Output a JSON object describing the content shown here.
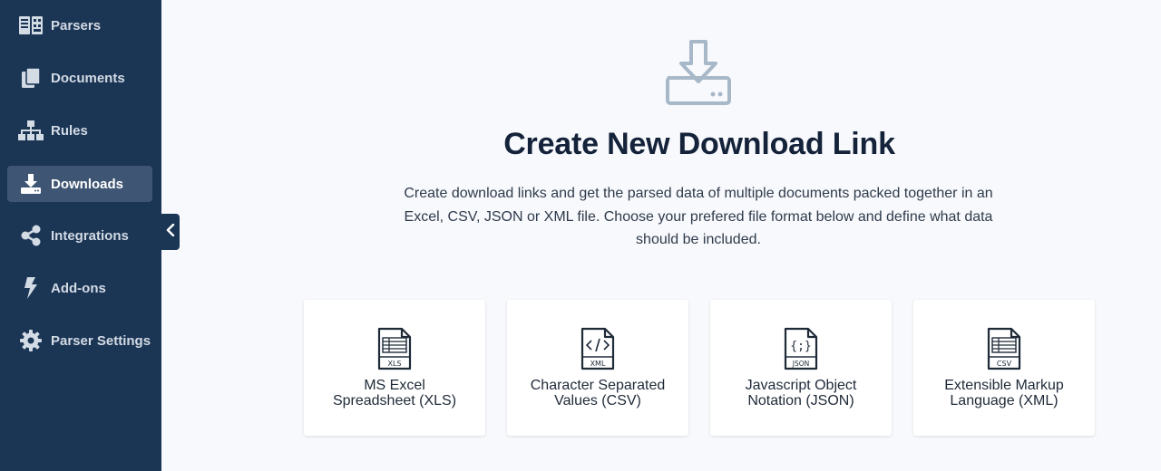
{
  "sidebar": {
    "items": [
      {
        "label": "Parsers",
        "icon": "parsers-icon"
      },
      {
        "label": "Documents",
        "icon": "documents-icon"
      },
      {
        "label": "Rules",
        "icon": "rules-icon"
      },
      {
        "label": "Downloads",
        "icon": "downloads-icon",
        "active": true
      },
      {
        "label": "Integrations",
        "icon": "share-icon"
      },
      {
        "label": "Add-ons",
        "icon": "lightning-icon"
      },
      {
        "label": "Parser Settings",
        "icon": "gear-icon"
      }
    ]
  },
  "main": {
    "title": "Create New Download Link",
    "description": "Create download links and get the parsed data of multiple documents packed together in an Excel, CSV, JSON or XML file. Choose your prefered file format below and define what data should be included.",
    "cards": [
      {
        "file_tag": "XLS",
        "label_line1": "MS Excel",
        "label_line2": "Spreadsheet (XLS)",
        "icon": "xls-file-icon"
      },
      {
        "file_tag": "XML",
        "label_line1": "Character Separated",
        "label_line2": "Values (CSV)",
        "icon": "xml-file-icon"
      },
      {
        "file_tag": "JSON",
        "label_line1": "Javascript Object",
        "label_line2": "Notation (JSON)",
        "icon": "json-file-icon"
      },
      {
        "file_tag": "CSV",
        "label_line1": "Extensible Markup",
        "label_line2": "Language (XML)",
        "icon": "csv-file-icon"
      }
    ]
  },
  "colors": {
    "sidebar_bg": "#1b3554",
    "sidebar_active": "#3e5673",
    "page_bg": "#f8f9fc",
    "title": "#14233a",
    "hero_icon": "#a7b8c8"
  }
}
